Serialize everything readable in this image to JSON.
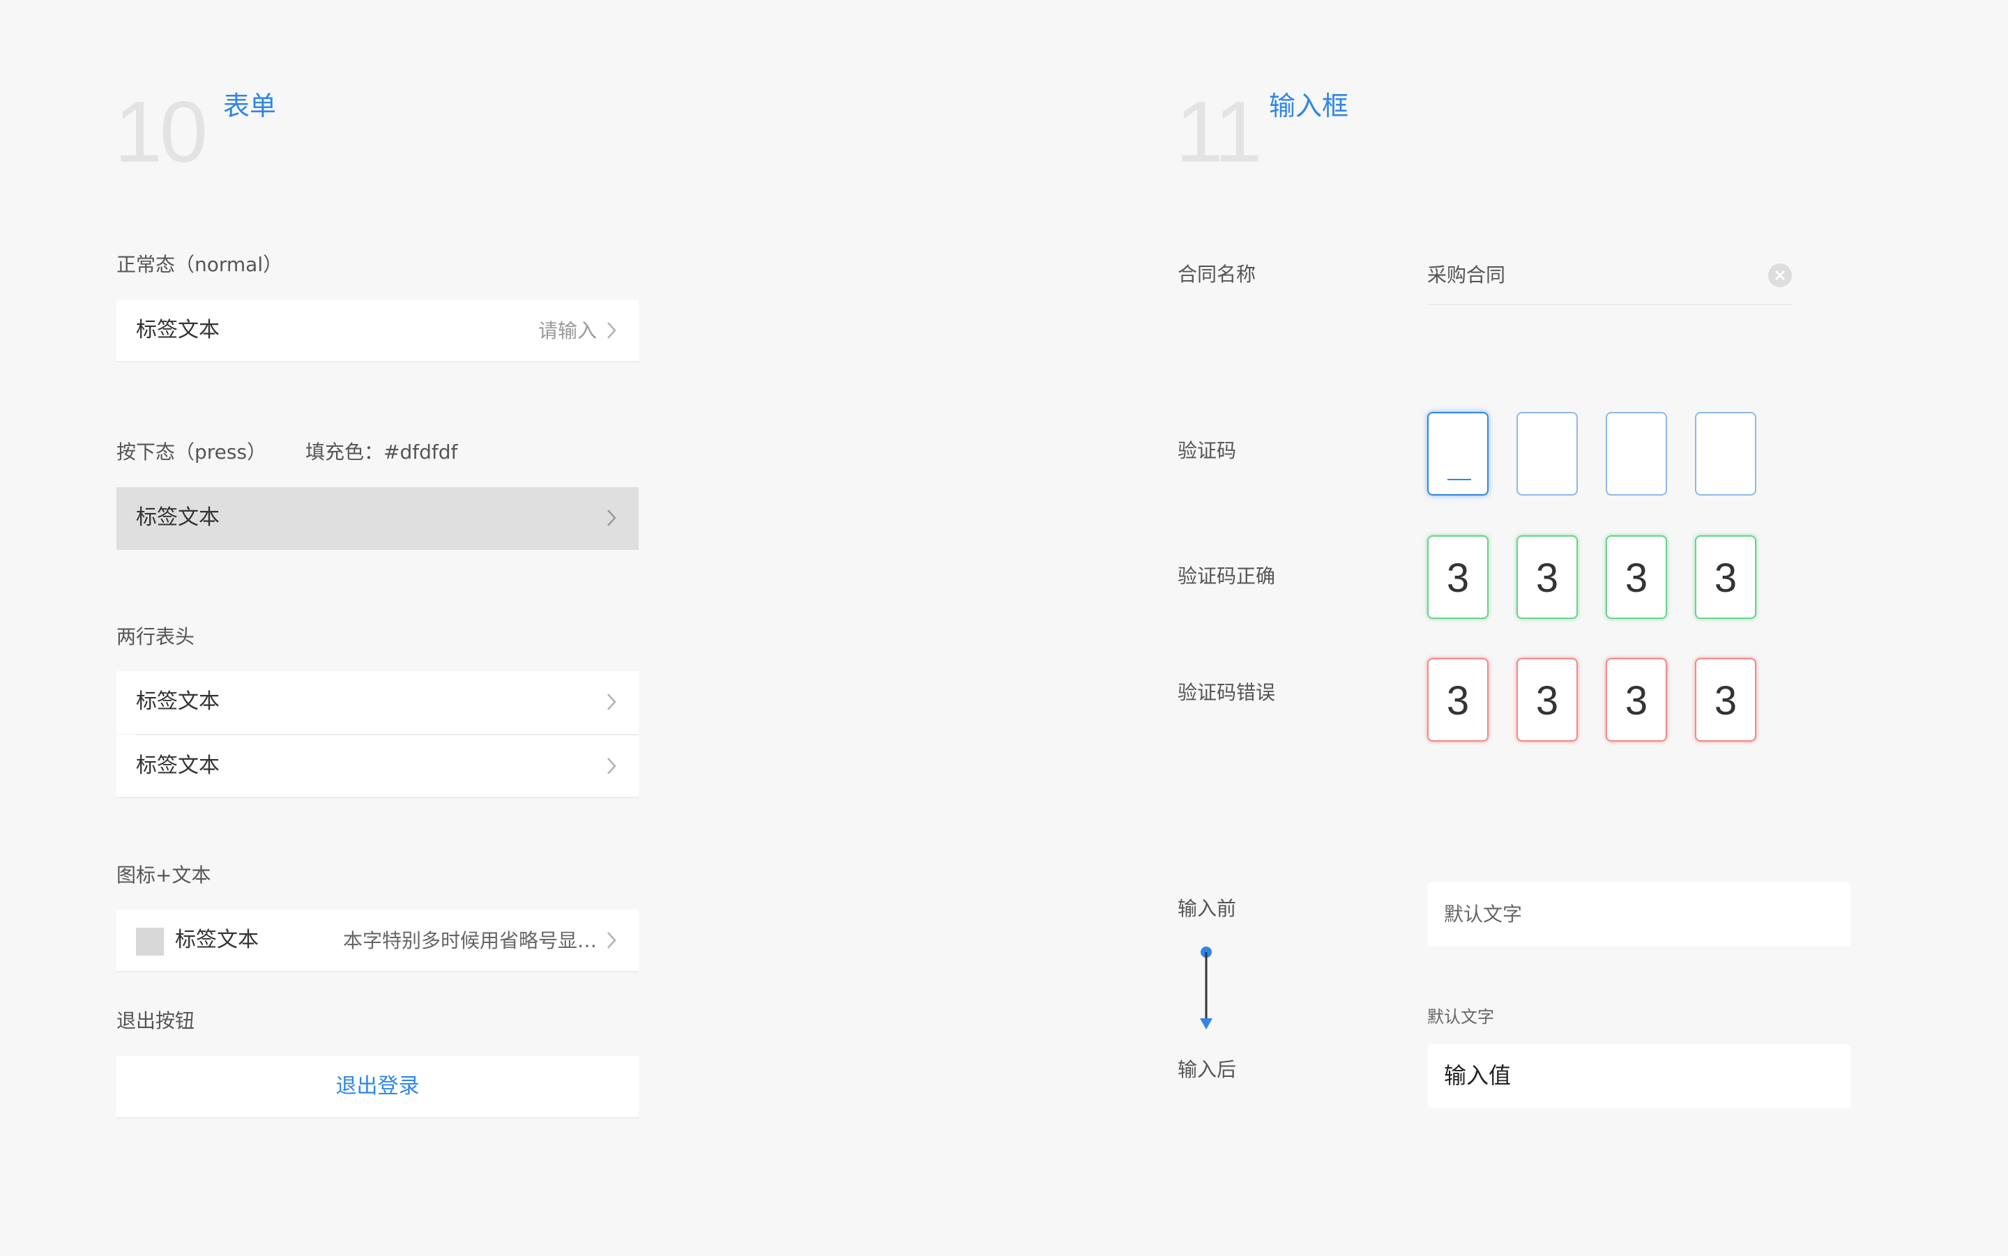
{
  "form_section": {
    "number": "10",
    "title": "表单",
    "normal": {
      "label": "正常态（normal）",
      "row_label": "标签文本",
      "row_placeholder": "请输入"
    },
    "press": {
      "label": "按下态（press）",
      "fill_note": "填充色：#dfdfdf",
      "row_label": "标签文本",
      "fill_color": "#dfdfdf"
    },
    "two_row": {
      "label": "两行表头",
      "rows": [
        "标签文本",
        "标签文本"
      ]
    },
    "icon_text": {
      "label": "图标+文本",
      "row_label": "标签文本",
      "row_value": "本字特别多时候用省略号显…"
    },
    "logout": {
      "label": "退出按钮",
      "button_label": "退出登录"
    }
  },
  "input_section": {
    "number": "11",
    "title": "输入框",
    "contract": {
      "label": "合同名称",
      "value": "采购合同"
    },
    "code": {
      "label": "验证码",
      "boxes": [
        "",
        "",
        "",
        ""
      ]
    },
    "code_ok": {
      "label": "验证码正确",
      "boxes": [
        "3",
        "3",
        "3",
        "3"
      ]
    },
    "code_err": {
      "label": "验证码错误",
      "boxes": [
        "3",
        "3",
        "3",
        "3"
      ]
    },
    "before": {
      "label": "输入前",
      "placeholder": "默认文字"
    },
    "after": {
      "label": "输入后",
      "float_label": "默认文字",
      "value": "输入值"
    }
  },
  "colors": {
    "accent": "#2f86e8",
    "success": "#6ad38c",
    "error": "#f28a8a",
    "pressed": "#dfdfdf"
  }
}
